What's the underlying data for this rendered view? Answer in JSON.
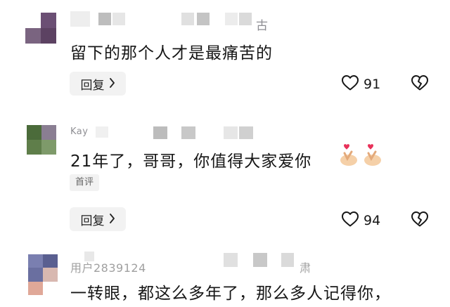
{
  "comments": [
    {
      "username_suffix": "古",
      "text": "留下的那个人才是最痛苦的",
      "reply_label": "回复",
      "likes": "91"
    },
    {
      "username": "Kay",
      "text": "21年了，哥哥，你值得大家爱你",
      "tag": "首评",
      "reply_label": "回复",
      "likes": "94"
    },
    {
      "username": "用户2839124",
      "username_suffix": "肃",
      "text": "一转眼，都这么多年了，那么多人记得你，"
    }
  ],
  "icons": {
    "like": "heart-outline-icon",
    "dislike": "broken-heart-icon",
    "reply_chevron": "chevron-right-icon",
    "emoji": "finger-heart-emoji"
  },
  "colors": {
    "text": "#161616",
    "muted": "#8e8e93",
    "button_bg": "#f2f2f2"
  }
}
